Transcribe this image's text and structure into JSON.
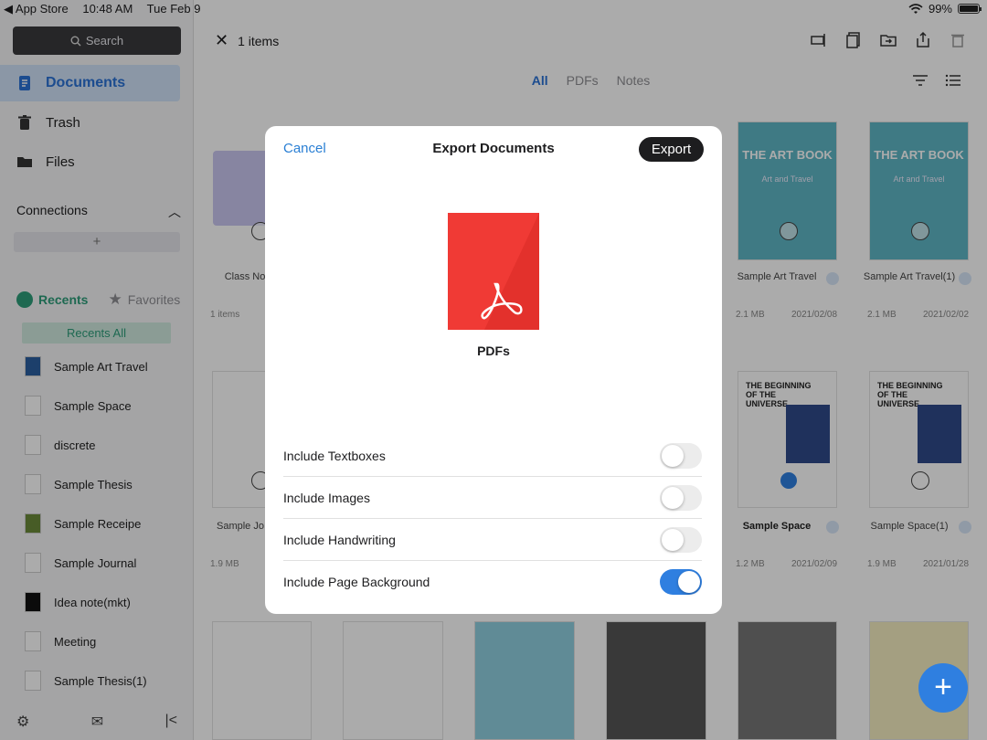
{
  "status_bar": {
    "back_app": "◀ App Store",
    "time": "10:48 AM",
    "date": "Tue Feb 9",
    "battery": "99%"
  },
  "sidebar": {
    "search_label": "Search",
    "nav": [
      {
        "label": "Documents"
      },
      {
        "label": "Trash"
      },
      {
        "label": "Files"
      }
    ],
    "connections_label": "Connections",
    "recents_label": "Recents",
    "favorites_label": "Favorites",
    "recents_all_label": "Recents All",
    "recents": [
      {
        "label": "Sample Art Travel"
      },
      {
        "label": "Sample Space"
      },
      {
        "label": "discrete"
      },
      {
        "label": "Sample Thesis"
      },
      {
        "label": "Sample Receipe"
      },
      {
        "label": "Sample Journal"
      },
      {
        "label": "Idea note(mkt)"
      },
      {
        "label": "Meeting"
      },
      {
        "label": "Sample Thesis(1)"
      }
    ]
  },
  "main": {
    "selection_label": "1 items",
    "tabs": [
      {
        "label": "All"
      },
      {
        "label": "PDFs"
      },
      {
        "label": "Notes"
      }
    ],
    "docs": [
      {
        "title": "Class No",
        "meta_size": "1 items",
        "meta_date": ""
      },
      {
        "title": "Sample Art Travel",
        "meta_size": "2.1 MB",
        "meta_date": "2021/02/08",
        "cover": "THE ART BOOK",
        "cover_sub": "Art and Travel"
      },
      {
        "title": "Sample Art Travel(1)",
        "meta_size": "2.1 MB",
        "meta_date": "2021/02/02",
        "cover": "THE ART BOOK",
        "cover_sub": "Art and Travel"
      },
      {
        "title": "Sample Jo",
        "meta_size": "1.9 MB",
        "meta_date": ""
      },
      {
        "title": "Sample Space",
        "meta_size": "1.2 MB",
        "meta_date": "2021/02/09",
        "cover": "THE BEGINNING OF THE UNIVERSE"
      },
      {
        "title": "Sample Space(1)",
        "meta_size": "1.9 MB",
        "meta_date": "2021/01/28",
        "cover": "THE BEGINNING OF THE UNIVERSE"
      }
    ]
  },
  "modal": {
    "cancel_label": "Cancel",
    "title": "Export Documents",
    "export_label": "Export",
    "format_label": "PDFs",
    "options": [
      {
        "label": "Include Textboxes",
        "enabled": false
      },
      {
        "label": "Include Images",
        "enabled": false
      },
      {
        "label": "Include Handwriting",
        "enabled": false
      },
      {
        "label": "Include Page Background",
        "enabled": true
      }
    ]
  },
  "fab_label": "+",
  "colors": {
    "accent": "#2f7fe0",
    "pdf": "#f03a35",
    "recents": "#2e9d7a"
  }
}
